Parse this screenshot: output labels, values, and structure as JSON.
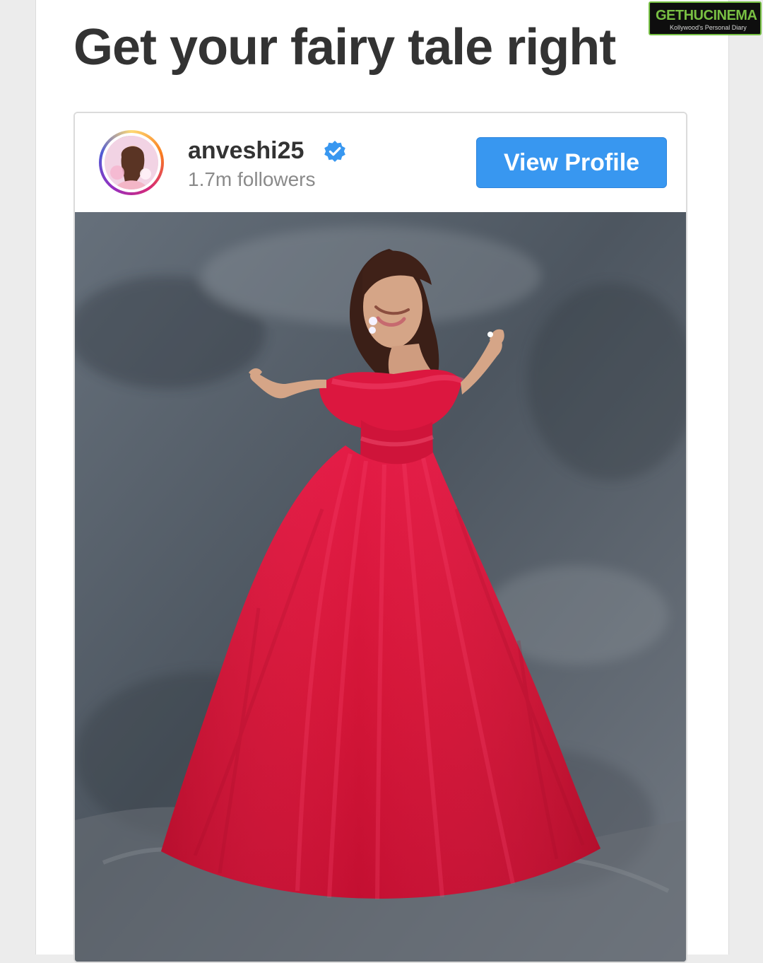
{
  "headline": "Get your fairy tale right",
  "profile": {
    "username": "anveshi25",
    "verified": true,
    "followers_text": "1.7m followers",
    "view_button_label": "View Profile"
  },
  "watermark": {
    "name": "GETHUCINEMA",
    "subtitle": "Kollywood's Personal Diary"
  },
  "icons": {
    "verified": "verified-badge-icon",
    "avatar": "profile-avatar"
  },
  "colors": {
    "button_blue": "#3897f0",
    "verified_blue": "#3897f0",
    "dress_red": "#d7193b",
    "backdrop_gray": "#56606a"
  }
}
